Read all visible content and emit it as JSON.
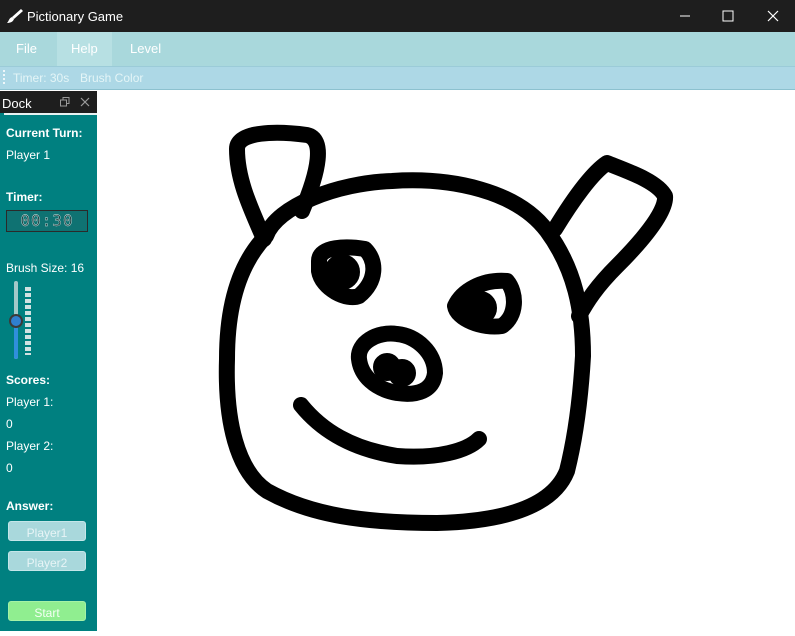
{
  "window": {
    "title": "Pictionary Game",
    "icon": "paintbrush-icon",
    "controls": [
      "minimize-icon",
      "maximize-icon",
      "close-icon"
    ]
  },
  "menubar": {
    "file": "File",
    "help": "Help",
    "level": "Level"
  },
  "toolbar": {
    "timer": "Timer: 30s",
    "brush_color": "Brush Color"
  },
  "dock": {
    "title": "Dock",
    "current_turn_label": "Current Turn:",
    "current_turn_value": "Player 1",
    "timer_label": "Timer:",
    "timer_display": "00:30",
    "brush_size_label": "Brush Size: 16",
    "brush_slider": {
      "value": 16,
      "fraction": 0.45
    },
    "scores_label": "Scores:",
    "player1_label": "Player 1:",
    "player1_score": "0",
    "player2_label": "Player 2:",
    "player2_score": "0",
    "answer_label": "Answer:",
    "player1_button": "Player1",
    "player2_button": "Player2",
    "start_button": "Start"
  },
  "colors": {
    "titlebar": "#1e1e1e",
    "menubar": "#a9d8dc",
    "toolbar": "#add8e6",
    "dock": "#008080",
    "start_button": "#90ee90",
    "canvas": "#ffffff",
    "stroke": "#000000"
  },
  "canvas": {
    "drawing": "pig-face-sketch"
  }
}
